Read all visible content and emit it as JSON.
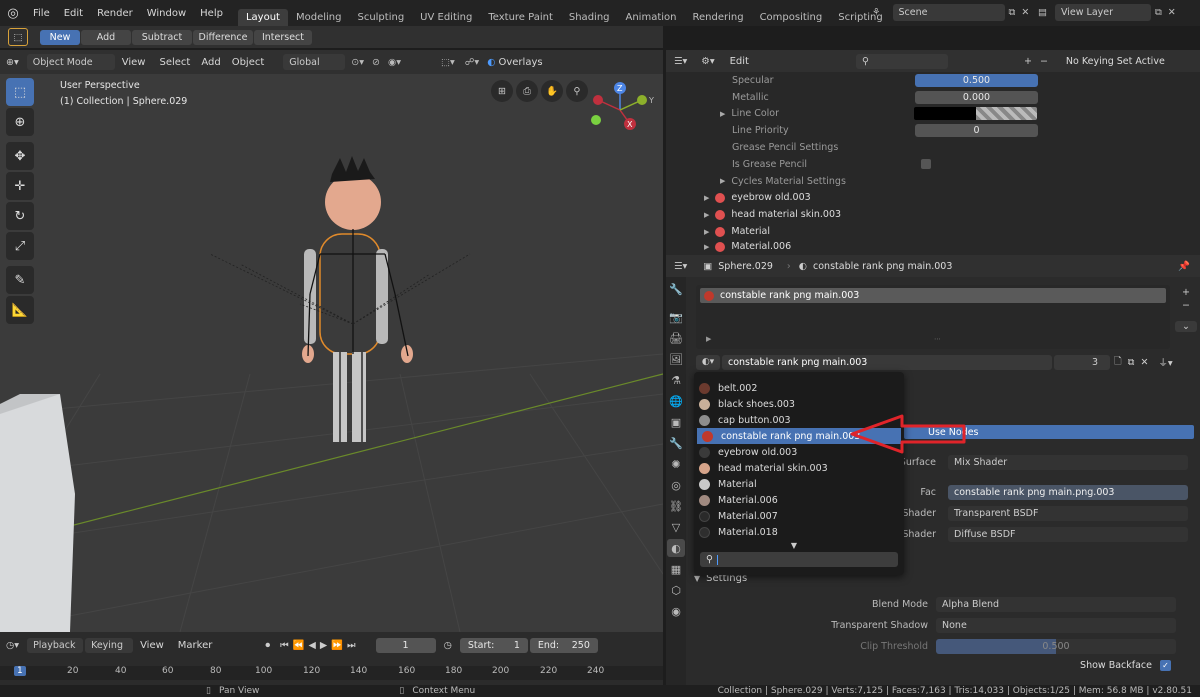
{
  "topbar": {
    "menus": [
      "File",
      "Edit",
      "Render",
      "Window",
      "Help"
    ],
    "workspaces": [
      "Layout",
      "Modeling",
      "Sculpting",
      "UV Editing",
      "Texture Paint",
      "Shading",
      "Animation",
      "Rendering",
      "Compositing",
      "Scripting"
    ],
    "active_workspace": "Layout",
    "add_tab": "+",
    "scene": "Scene",
    "view_layer": "View Layer"
  },
  "tool_settings": {
    "new": "New",
    "add": "Add",
    "subtract": "Subtract",
    "difference": "Difference",
    "intersect": "Intersect"
  },
  "viewport_header": {
    "mode": "Object Mode",
    "view": "View",
    "select": "Select",
    "add": "Add",
    "object": "Object",
    "transform": "Global",
    "overlays": "Overlays"
  },
  "viewport": {
    "perspective": "User Perspective",
    "collection": "(1) Collection | Sphere.029",
    "axis_x": "X",
    "axis_y": "Y",
    "axis_z": "Z"
  },
  "outliner_header": {
    "edit": "Edit",
    "keying": "No Keying Set Active"
  },
  "outliner": {
    "props": [
      {
        "label": "Specular",
        "value": "0.500"
      },
      {
        "label": "Metallic",
        "value": "0.000"
      },
      {
        "label": "Line Color",
        "value": ""
      },
      {
        "label": "Line Priority",
        "value": "0"
      },
      {
        "label": "Grease Pencil Settings",
        "value": ""
      },
      {
        "label": "Is Grease Pencil",
        "value": ""
      },
      {
        "label": "Cycles Material Settings",
        "value": ""
      }
    ],
    "materials": [
      "eyebrow old.003",
      "head material skin.003",
      "Material",
      "Material.006"
    ]
  },
  "properties": {
    "object": "Sphere.029",
    "material": "constable rank png main.003",
    "slot": "constable rank png main.003",
    "material_field": "constable rank png main.003",
    "users": "3",
    "use_nodes": "Use Nodes",
    "surface_label": "Surface",
    "surface_value": "Mix Shader",
    "fac_label": "Fac",
    "fac_value": "constable rank png main.png.003",
    "shader1_label": "Shader",
    "shader1_value": "Transparent BSDF",
    "shader2_label": "Shader",
    "shader2_value": "Diffuse BSDF",
    "settings": "Settings",
    "blend_mode_label": "Blend Mode",
    "blend_mode_value": "Alpha Blend",
    "shadow_label": "Transparent Shadow",
    "shadow_value": "None",
    "clip_label": "Clip Threshold",
    "clip_value": "0.500",
    "backface_label": "Show Backface"
  },
  "dropdown": {
    "items": [
      {
        "label": "belt.002",
        "color": "#6b3a2e"
      },
      {
        "label": "black shoes.003",
        "color": "#c9b09a"
      },
      {
        "label": "cap button.003",
        "color": "#8d8d8d"
      },
      {
        "label": "constable rank png main.003",
        "color": "#c0392b"
      },
      {
        "label": "eyebrow old.003",
        "color": "#3a3a3a"
      },
      {
        "label": "head material skin.003",
        "color": "#d6a48a"
      },
      {
        "label": "Material",
        "color": "#c8c8c8"
      },
      {
        "label": "Material.006",
        "color": "#a08a80"
      },
      {
        "label": "Material.007",
        "color": "#2a2a2a"
      },
      {
        "label": "Material.018",
        "color": "#2e2e2e"
      }
    ],
    "selected_index": 3
  },
  "timeline": {
    "playback": "Playback",
    "keying": "Keying",
    "view": "View",
    "marker": "Marker",
    "current_frame": "1",
    "start_label": "Start:",
    "start": "1",
    "end_label": "End:",
    "end": "250",
    "ticks": [
      "1",
      "20",
      "40",
      "60",
      "80",
      "100",
      "120",
      "140",
      "160",
      "180",
      "200",
      "220",
      "240"
    ]
  },
  "statusbar": {
    "pan": "Pan View",
    "context": "Context Menu",
    "stats": "Collection | Sphere.029 | Verts:7,125 | Faces:7,163 | Tris:14,033 | Objects:1/25 | Mem: 56.8 MB | v2.80.51"
  }
}
